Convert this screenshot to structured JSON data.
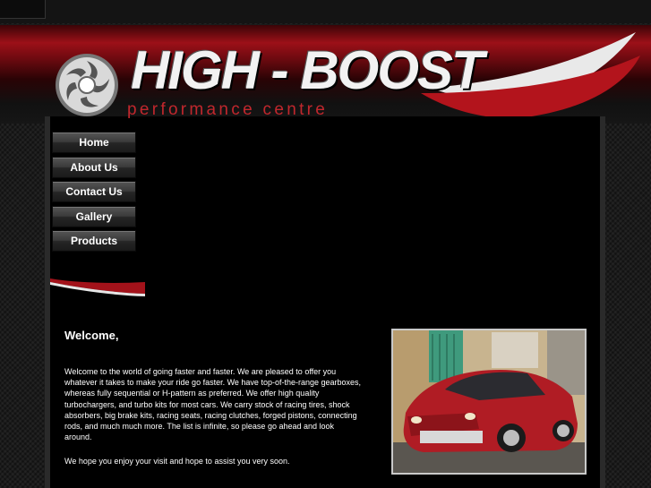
{
  "brand": {
    "name": "HIGH - BOOST",
    "tagline": "performance centre",
    "accent_red": "#c1272d",
    "logo_icon": "turbo-icon"
  },
  "nav": {
    "items": [
      {
        "label": "Home"
      },
      {
        "label": "About Us"
      },
      {
        "label": "Contact Us"
      },
      {
        "label": "Gallery"
      },
      {
        "label": "Products"
      }
    ]
  },
  "welcome": {
    "title": "Welcome,",
    "body": "Welcome to the world of going faster and faster. We are pleased to offer you whatever it takes to make your ride go faster. We have top-of-the-range gearboxes, whereas fully sequential or H-pattern as preferred. We offer high quality turbochargers, and turbo kits for most cars. We carry stock of racing tires, shock absorbers, big brake kits, racing seats, racing clutches, forged pistons, connecting rods, and much much more. The list is infinite, so please go ahead and look around.",
    "closing": "We hope you enjoy your visit and hope to assist you very soon."
  },
  "photo": {
    "subject": "red-tuned-hatchback-photo"
  }
}
